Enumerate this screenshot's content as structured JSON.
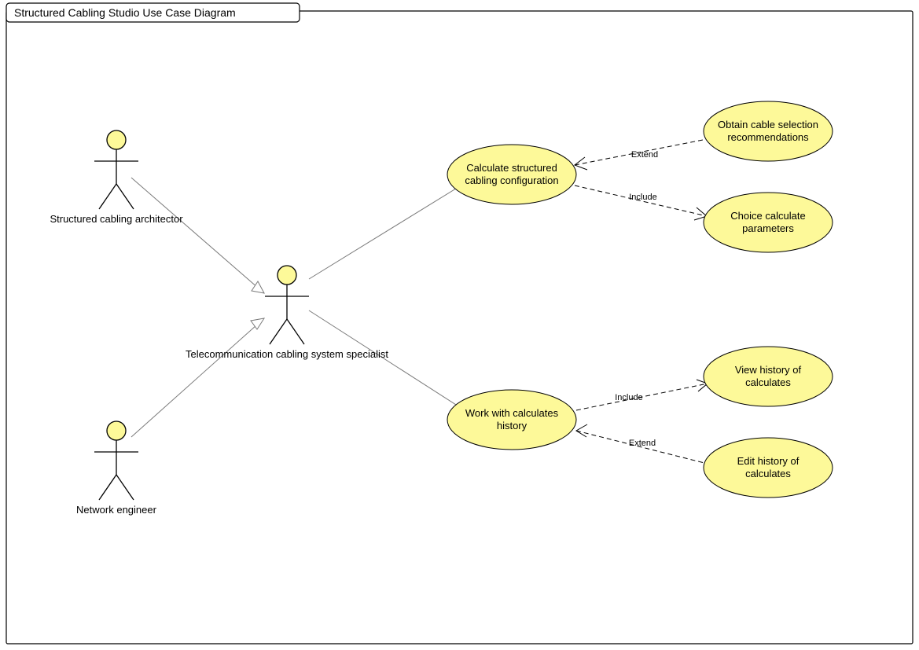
{
  "title": "Structured Cabling Studio Use Case Diagram",
  "actors": {
    "architector": {
      "label": "Structured cabling architector"
    },
    "specialist": {
      "label": "Telecommunication cabling system specialist"
    },
    "engineer": {
      "label": "Network engineer"
    }
  },
  "usecases": {
    "calc": {
      "label1": "Calculate structured",
      "label2": "cabling configuration"
    },
    "obtain": {
      "label1": "Obtain cable selection",
      "label2": "recommendations"
    },
    "choice": {
      "label1": "Choice calculate",
      "label2": "parameters"
    },
    "work": {
      "label1": "Work with calculates",
      "label2": "history"
    },
    "view": {
      "label1": "View history of",
      "label2": "calculates"
    },
    "edit": {
      "label1": "Edit history of",
      "label2": "calculates"
    }
  },
  "rel_labels": {
    "extend": "Extend",
    "include": "Include"
  }
}
